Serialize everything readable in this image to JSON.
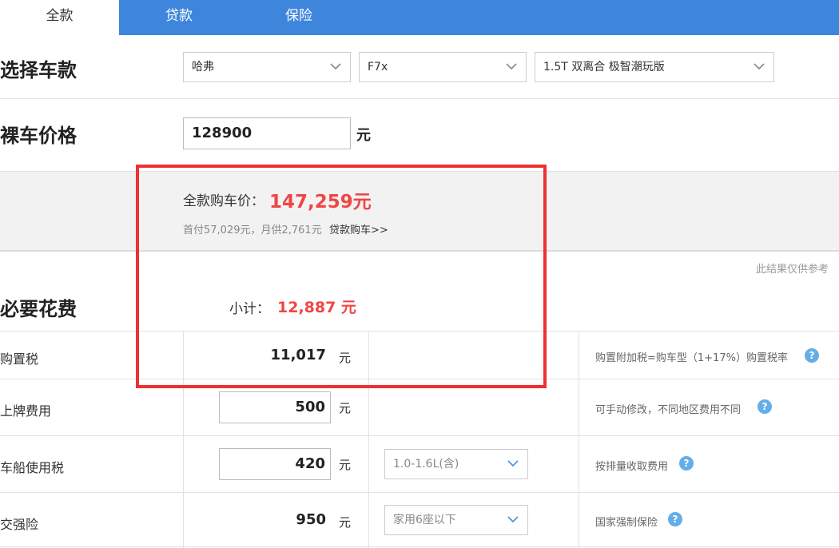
{
  "tabs": [
    {
      "label": "全款"
    },
    {
      "label": "贷款"
    },
    {
      "label": "保险"
    }
  ],
  "select_car": {
    "heading": "选择车款",
    "brand": "哈弗",
    "series": "F7x",
    "model": "1.5T 双离合 极智潮玩版"
  },
  "bare_price": {
    "heading": "裸车价格",
    "value": "128900",
    "unit": "元"
  },
  "summary": {
    "full_label": "全款购车价：",
    "full_value": "147,259元",
    "sub_note": "首付57,029元，月供2,761元",
    "loan_link": "贷款购车>>"
  },
  "disclaimer": "此结果仅供参考",
  "required": {
    "heading": "必要花费",
    "subtotal_label": "小计：",
    "subtotal_value": "12,887 元"
  },
  "rows": [
    {
      "label": "购置税",
      "value": "11,017",
      "unit": "元",
      "note": "购置附加税=购车型（1+17%）购置税率"
    },
    {
      "label": "上牌费用",
      "value": "500",
      "unit": "元",
      "note": "可手动修改，不同地区费用不同"
    },
    {
      "label": "车船使用税",
      "value": "420",
      "unit": "元",
      "option": "1.0-1.6L(含)",
      "note": "按排量收取费用"
    },
    {
      "label": "交强险",
      "value": "950",
      "unit": "元",
      "option": "家用6座以下",
      "note": "国家强制保险"
    }
  ],
  "icons": {
    "help": "?",
    "dropdown": "chevron-down-icon",
    "help_icon": "question-circle-icon"
  },
  "colors": {
    "tab_bar": "#3e86dc",
    "highlight_red": "#f04545",
    "annotation_box": "#ee3035",
    "help_blue": "#63aee8"
  }
}
